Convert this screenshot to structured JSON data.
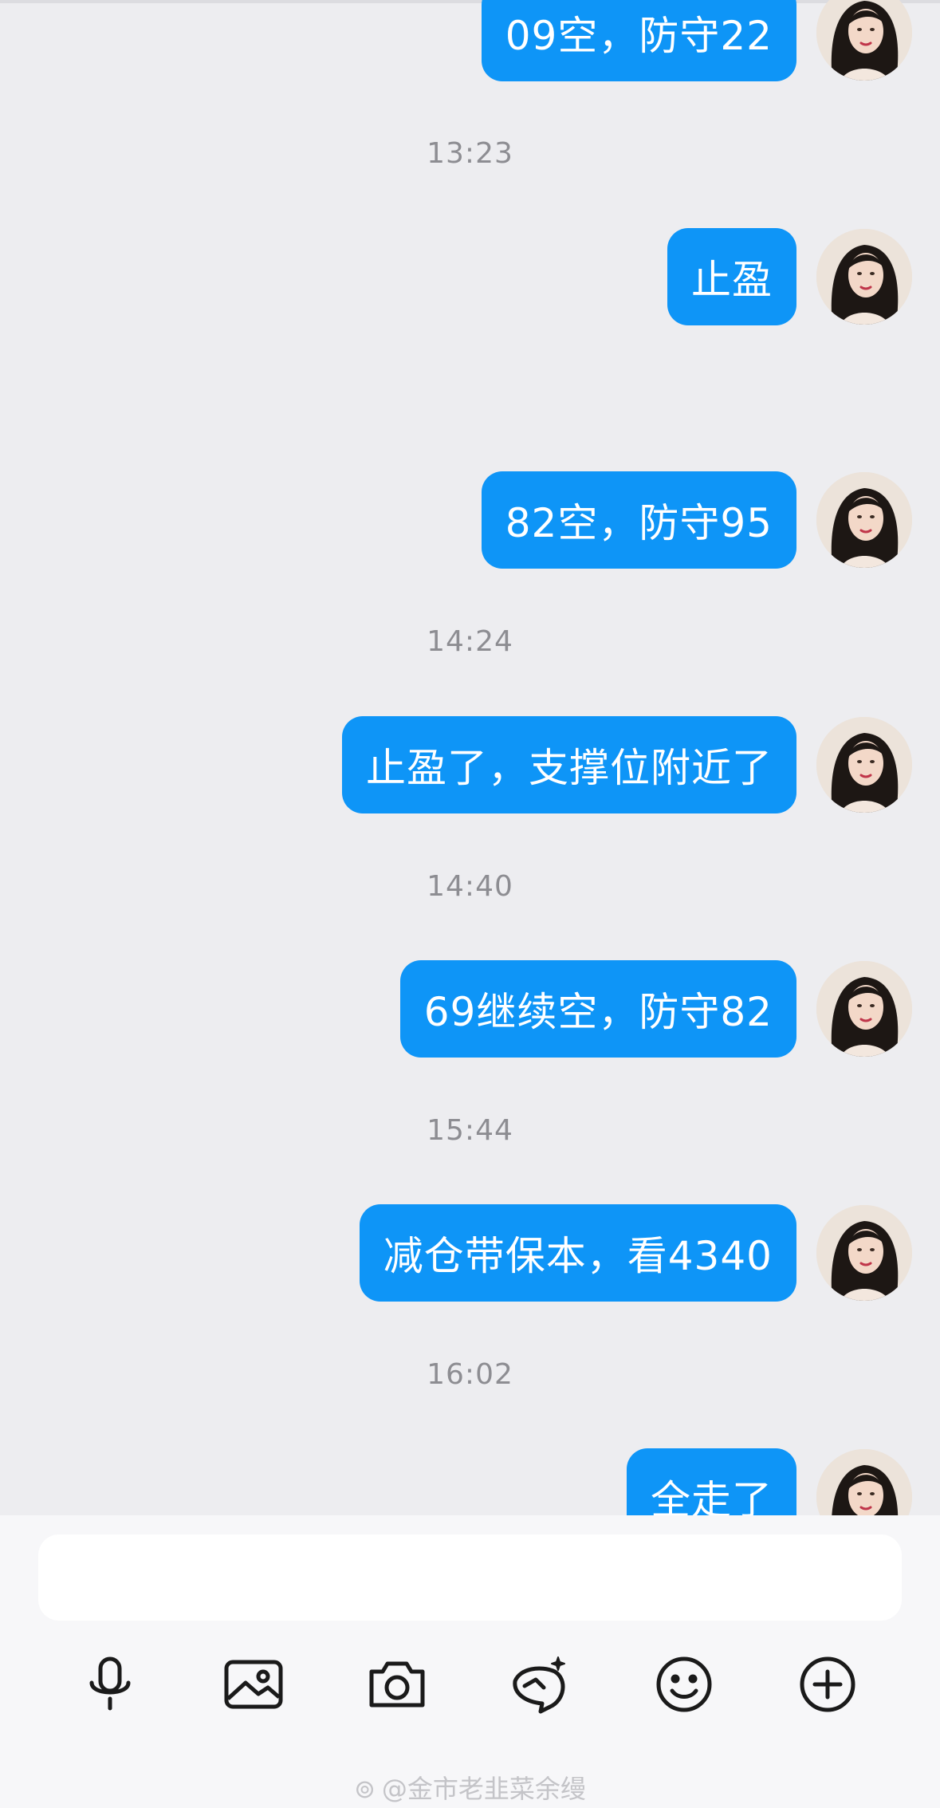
{
  "messages": [
    {
      "text": "09空，防守22"
    },
    {
      "text": "止盈"
    },
    {
      "text": "82空，防守95"
    },
    {
      "text": "止盈了，支撑位附近了"
    },
    {
      "text": "69继续空，防守82"
    },
    {
      "text": "减仓带保本，看4340"
    },
    {
      "text": "全走了"
    }
  ],
  "timestamps": [
    "13:23",
    "14:24",
    "14:40",
    "15:44",
    "16:02"
  ],
  "composer": {
    "input_value": "",
    "tools": [
      "microphone-icon",
      "image-icon",
      "camera-icon",
      "sticker-icon",
      "smile-icon",
      "plus-icon"
    ]
  },
  "watermark": {
    "text": "@金市老韭菜余缦"
  },
  "colors": {
    "bubble": "#0e95f7",
    "background": "#ededf0",
    "timestamp": "#8d8d92"
  }
}
